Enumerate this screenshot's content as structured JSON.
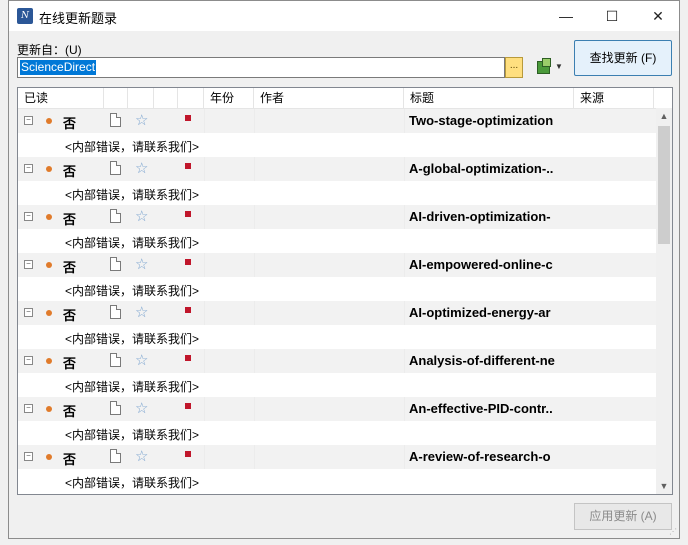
{
  "window": {
    "title": "在线更新题录",
    "minimize": "—",
    "maximize": "☐",
    "close": "✕"
  },
  "source": {
    "label": "更新自：(U)",
    "value": "ScienceDirect",
    "browse_label": "..."
  },
  "buttons": {
    "find_updates": "查找更新 (F)",
    "apply_updates": "应用更新 (A)"
  },
  "columns": [
    "已读",
    "",
    "",
    "",
    "",
    "年份",
    "作者",
    "标题",
    "来源"
  ],
  "icons": {
    "expander": "minus-box-icon",
    "dot": "orange-dot-icon",
    "doc": "document-icon",
    "star": "star-outline-icon",
    "flag": "red-flag-icon"
  },
  "rows": [
    {
      "read": "否",
      "title": "Two-stage-optimization",
      "note": "<内部错误，请联系我们>"
    },
    {
      "read": "否",
      "title": "A-global-optimization-..",
      "note": "<内部错误，请联系我们>"
    },
    {
      "read": "否",
      "title": "AI-driven-optimization-",
      "note": "<内部错误，请联系我们>"
    },
    {
      "read": "否",
      "title": "AI-empowered-online-c",
      "note": "<内部错误，请联系我们>"
    },
    {
      "read": "否",
      "title": "AI-optimized-energy-ar",
      "note": "<内部错误，请联系我们>"
    },
    {
      "read": "否",
      "title": "Analysis-of-different-ne",
      "note": "<内部错误，请联系我们>"
    },
    {
      "read": "否",
      "title": "An-effective-PID-contr..",
      "note": "<内部错误，请联系我们>"
    },
    {
      "read": "否",
      "title": "A-review-of-research-o",
      "note": "<内部错误，请联系我们>"
    }
  ]
}
